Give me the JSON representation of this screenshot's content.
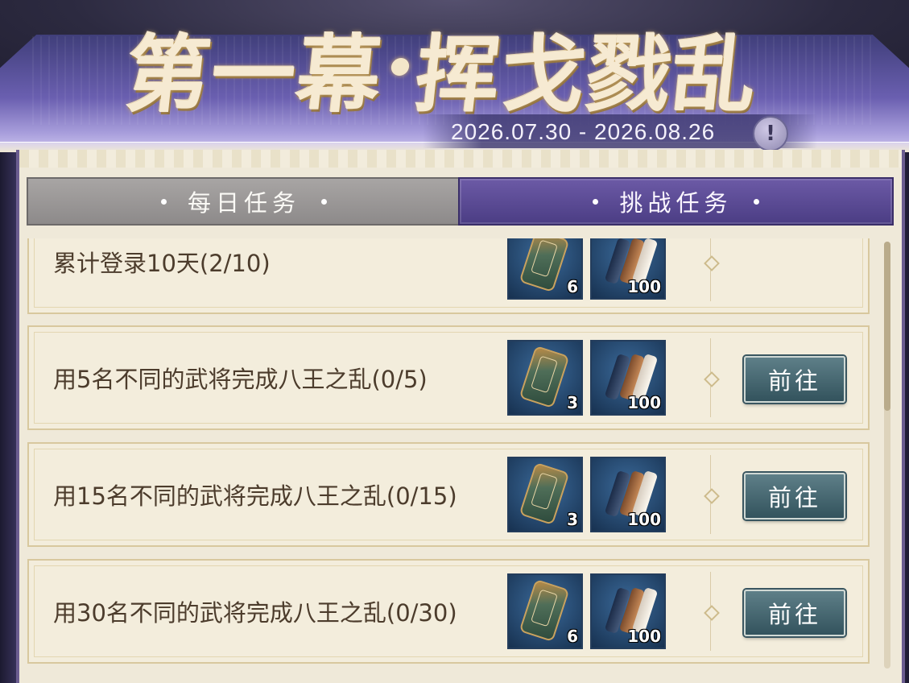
{
  "header": {
    "title_part1": "第一幕",
    "title_part2": "挥戈戮乱",
    "date_range": "2026.07.30 - 2026.08.26",
    "info_symbol": "!"
  },
  "tabs": [
    {
      "label": "每日任务",
      "active": false
    },
    {
      "label": "挑战任务",
      "active": true
    }
  ],
  "quests": [
    {
      "description": "累计登录10天(2/10)",
      "rewards": [
        {
          "icon": "token-icon",
          "count": "6"
        },
        {
          "icon": "scroll-bundle-icon",
          "count": "100"
        }
      ],
      "button": ""
    },
    {
      "description": "用5名不同的武将完成八王之乱(0/5)",
      "rewards": [
        {
          "icon": "token-icon",
          "count": "3"
        },
        {
          "icon": "scroll-bundle-icon",
          "count": "100"
        }
      ],
      "button": "前往"
    },
    {
      "description": "用15名不同的武将完成八王之乱(0/15)",
      "rewards": [
        {
          "icon": "token-icon",
          "count": "3"
        },
        {
          "icon": "scroll-bundle-icon",
          "count": "100"
        }
      ],
      "button": "前往"
    },
    {
      "description": "用30名不同的武将完成八王之乱(0/30)",
      "rewards": [
        {
          "icon": "token-icon",
          "count": "6"
        },
        {
          "icon": "scroll-bundle-icon",
          "count": "100"
        }
      ],
      "button": "前往"
    }
  ],
  "colors": {
    "active_tab": "#5a4a96",
    "inactive_tab": "#9a9797",
    "go_button": "#45666f",
    "panel": "#efe9d9"
  }
}
